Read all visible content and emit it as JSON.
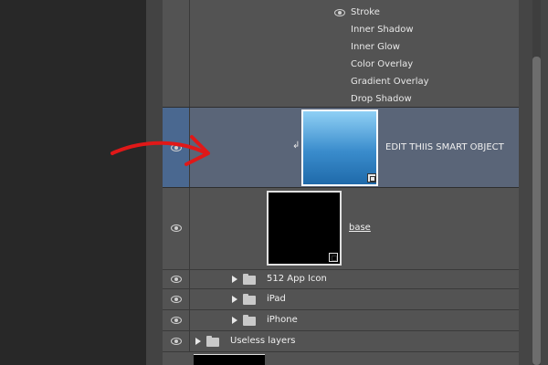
{
  "layer_effects": [
    "Stroke",
    "Inner Shadow",
    "Inner Glow",
    "Color Overlay",
    "Gradient Overlay",
    "Drop Shadow"
  ],
  "layers": {
    "smart_object": {
      "name": "EDIT THIIS SMART OBJECT"
    },
    "base": {
      "name": "base"
    },
    "group_512": {
      "name": "512 App Icon"
    },
    "group_ipad": {
      "name": "iPad"
    },
    "group_iphone": {
      "name": "iPhone"
    },
    "group_useless": {
      "name": "Useless layers"
    }
  },
  "colors": {
    "selected_row": "#5a6578",
    "selected_eye_col": "#4a6890",
    "arrow": "#e01818",
    "thumb_gradient_top": "#8fd0f5",
    "thumb_gradient_bottom": "#1f6aaa"
  },
  "icons": [
    "eye-icon",
    "folder-icon",
    "disclosure-triangle-icon",
    "smart-object-badge-icon",
    "clip-arrow-icon"
  ]
}
